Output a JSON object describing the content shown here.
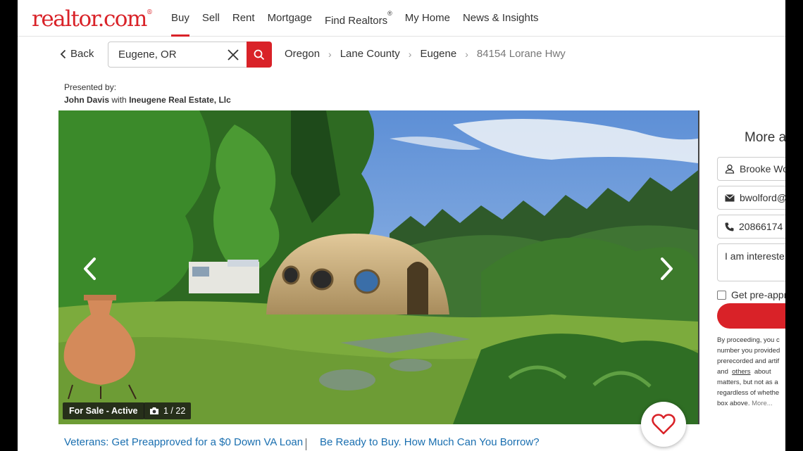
{
  "brand": {
    "logo_text": "realtor.com",
    "logo_mark": "®",
    "accent_color": "#d92228"
  },
  "nav": {
    "items": [
      {
        "label": "Buy",
        "active": true
      },
      {
        "label": "Sell"
      },
      {
        "label": "Rent"
      },
      {
        "label": "Mortgage"
      },
      {
        "label": "Find Realtors",
        "sup": "®"
      },
      {
        "label": "My Home"
      },
      {
        "label": "News & Insights"
      }
    ]
  },
  "search": {
    "back_label": "Back",
    "value": "Eugene, OR",
    "placeholder": ""
  },
  "breadcrumb": [
    "Oregon",
    "Lane County",
    "Eugene",
    "84154 Lorane Hwy"
  ],
  "presented": {
    "prefix": "Presented by:",
    "agent": "John Davis",
    "connector": "with",
    "brokerage": "Ineugene Real Estate, Llc"
  },
  "photo": {
    "status": "For Sale - Active",
    "counter": "1 / 22"
  },
  "contact_panel": {
    "title": "More a",
    "name_value": "Brooke Wo",
    "email_value": "bwolford@",
    "phone_value": "20866174",
    "message_value": "I am intereste",
    "preapproval_label": "Get pre-appr",
    "disclaimer_lines": [
      "By proceeding, you c",
      "number you provided",
      "prerecorded and artif",
      "and [others] about",
      "matters, but not as a",
      "regardless of whethe",
      "box above. [More...]"
    ],
    "disclaimer_link_1": "others",
    "disclaimer_link_2": "More..."
  },
  "bottom_links": {
    "va_loan": "Veterans: Get Preapproved for a $0 Down VA Loan",
    "borrow": "Be Ready to Buy. How Much Can You Borrow?"
  }
}
